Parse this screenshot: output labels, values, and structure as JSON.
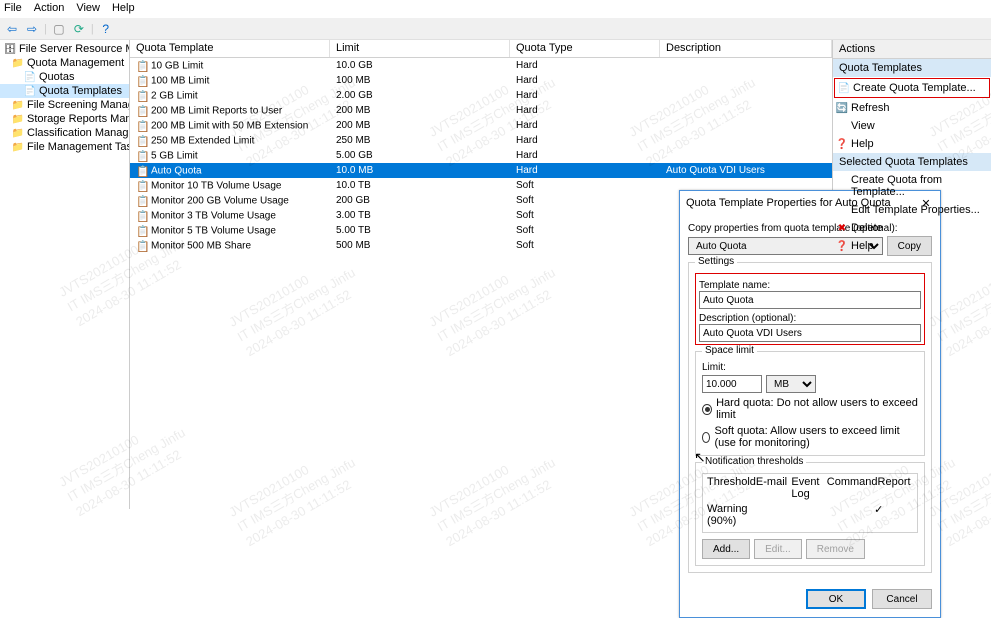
{
  "menubar": [
    "File",
    "Action",
    "View",
    "Help"
  ],
  "tree": {
    "root": "File Server Resource Manager (Local)",
    "items": [
      {
        "label": "Quota Management",
        "lvl": 1
      },
      {
        "label": "Quotas",
        "lvl": 2
      },
      {
        "label": "Quota Templates",
        "lvl": 2,
        "selected": true
      },
      {
        "label": "File Screening Management",
        "lvl": 1
      },
      {
        "label": "Storage Reports Management",
        "lvl": 1
      },
      {
        "label": "Classification Management",
        "lvl": 1
      },
      {
        "label": "File Management Tasks",
        "lvl": 1
      }
    ]
  },
  "list": {
    "cols": [
      "Quota Template",
      "Limit",
      "Quota Type",
      "Description"
    ],
    "rows": [
      {
        "t": "10 GB Limit",
        "l": "10.0 GB",
        "y": "Hard",
        "d": ""
      },
      {
        "t": "100 MB Limit",
        "l": "100 MB",
        "y": "Hard",
        "d": ""
      },
      {
        "t": "2 GB Limit",
        "l": "2.00 GB",
        "y": "Hard",
        "d": ""
      },
      {
        "t": "200 MB Limit Reports to User",
        "l": "200 MB",
        "y": "Hard",
        "d": ""
      },
      {
        "t": "200 MB Limit with 50 MB Extension",
        "l": "200 MB",
        "y": "Hard",
        "d": ""
      },
      {
        "t": "250 MB Extended Limit",
        "l": "250 MB",
        "y": "Hard",
        "d": ""
      },
      {
        "t": "5 GB Limit",
        "l": "5.00 GB",
        "y": "Hard",
        "d": ""
      },
      {
        "t": "Auto Quota",
        "l": "10.0 MB",
        "y": "Hard",
        "d": "Auto Quota VDI Users",
        "selected": true
      },
      {
        "t": "Monitor 10 TB Volume Usage",
        "l": "10.0 TB",
        "y": "Soft",
        "d": ""
      },
      {
        "t": "Monitor 200 GB Volume Usage",
        "l": "200 GB",
        "y": "Soft",
        "d": ""
      },
      {
        "t": "Monitor 3 TB Volume Usage",
        "l": "3.00 TB",
        "y": "Soft",
        "d": ""
      },
      {
        "t": "Monitor 5 TB Volume Usage",
        "l": "5.00 TB",
        "y": "Soft",
        "d": ""
      },
      {
        "t": "Monitor 500 MB Share",
        "l": "500 MB",
        "y": "Soft",
        "d": ""
      }
    ]
  },
  "actions": {
    "title": "Actions",
    "section1": "Quota Templates",
    "items1": [
      {
        "label": "Create Quota Template...",
        "icon": "📄",
        "hl": true
      },
      {
        "label": "Refresh",
        "icon": "🔄"
      },
      {
        "label": "View",
        "icon": ""
      },
      {
        "label": "Help",
        "icon": "❓"
      }
    ],
    "section2": "Selected Quota Templates",
    "items2": [
      {
        "label": "Create Quota from Template...",
        "icon": ""
      },
      {
        "label": "Edit Template Properties...",
        "icon": ""
      },
      {
        "label": "Delete",
        "icon": "✖",
        "iconColor": "#d00"
      },
      {
        "label": "Help",
        "icon": "❓"
      }
    ]
  },
  "dialog": {
    "title": "Quota Template Properties for Auto Quota",
    "copy_label": "Copy properties from quota template (optional):",
    "copy_value": "Auto Quota",
    "copy_btn": "Copy",
    "settings_title": "Settings",
    "tname_label": "Template name:",
    "tname_value": "Auto Quota",
    "desc_label": "Description (optional):",
    "desc_value": "Auto Quota VDI Users",
    "space_title": "Space limit",
    "limit_label": "Limit:",
    "limit_value": "10.000",
    "limit_unit": "MB",
    "hard_label": "Hard quota: Do not allow users to exceed limit",
    "soft_label": "Soft quota: Allow users to exceed limit (use for monitoring)",
    "thresh_title": "Notification thresholds",
    "thresh_cols": [
      "Threshold",
      "E-mail",
      "Event Log",
      "Command",
      "Report"
    ],
    "thresh_rows": [
      {
        "t": "Warning (90%)",
        "e": "",
        "v": "",
        "c": "",
        "r": "✓"
      }
    ],
    "add_btn": "Add...",
    "edit_btn": "Edit...",
    "remove_btn": "Remove",
    "ok_btn": "OK",
    "cancel_btn": "Cancel"
  },
  "watermark": "JVTS20210100\nIT IMS三方Cheng Jinfu\n2024-08-30 11:11:52"
}
